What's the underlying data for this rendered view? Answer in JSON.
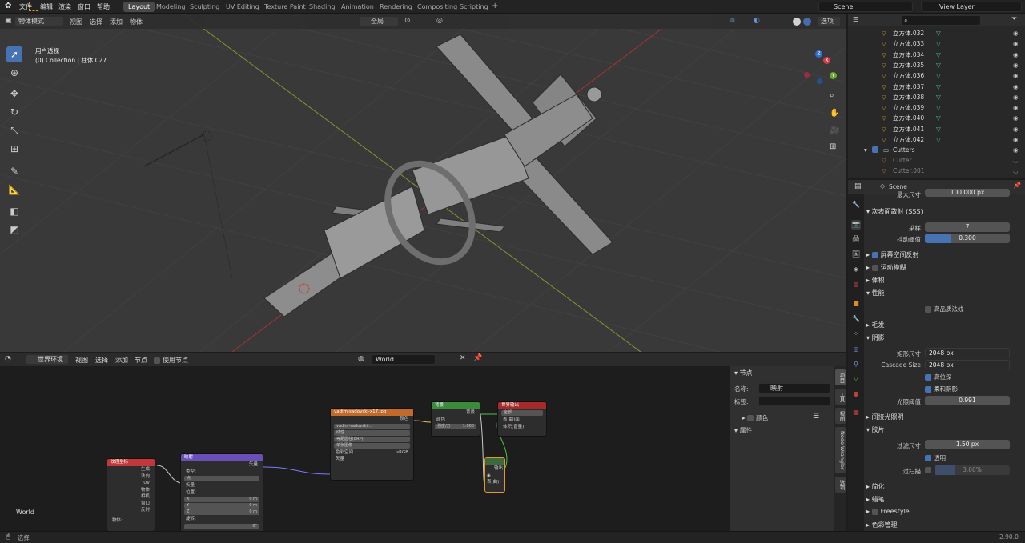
{
  "topbar": {
    "menus": [
      "文件",
      "编辑",
      "渲染",
      "窗口",
      "帮助"
    ],
    "workspaces": [
      "Layout",
      "Modeling",
      "Sculpting",
      "UV Editing",
      "Texture Paint",
      "Shading",
      "Animation",
      "Rendering",
      "Compositing",
      "Scripting"
    ],
    "scene": "Scene",
    "view_layer": "View Layer"
  },
  "viewport": {
    "mode": "物体模式",
    "menus": [
      "视图",
      "选择",
      "添加",
      "物体"
    ],
    "transform": "全局",
    "options": "选项",
    "view_name": "用户透视",
    "collection_info": "(0) Collection | 柱体.027",
    "gizmo_axes": [
      "X",
      "Y",
      "Z"
    ]
  },
  "node_editor": {
    "type": "世界环境",
    "menus": [
      "视图",
      "选择",
      "添加",
      "节点"
    ],
    "use_nodes": "使用节点",
    "world_name": "World",
    "world_label": "World",
    "nodes": {
      "texcoord": {
        "title": "纹理坐标",
        "outputs": [
          "生成",
          "法向",
          "UV",
          "物体",
          "相机",
          "窗口",
          "反射"
        ],
        "object_label": "物体:"
      },
      "mapping": {
        "title": "映射",
        "output": "矢量",
        "type_label": "类型:",
        "type_value": "点",
        "vector_label": "矢量",
        "location_label": "位置:",
        "x": "X",
        "y": "Y",
        "z": "Z",
        "x_val": "0 m",
        "y_val": "0 m",
        "z_val": "0 m",
        "rotation_label": "旋转:",
        "rot_x": "0°"
      },
      "envtex": {
        "title": "vadim-sadovski-x17.jpg",
        "output": "颜色",
        "image": "vadim-sadovski-...",
        "interp": "线性",
        "proj": "等距圆柱(ERP)",
        "ext": "单张图像",
        "colorspace_label": "色彩空间",
        "colorspace": "sRGB",
        "input": "矢量"
      },
      "background": {
        "title": "背景",
        "output": "背景",
        "color": "颜色",
        "strength_label": "强度/力",
        "strength": "1.000"
      },
      "output": {
        "title": "世界输出",
        "target": "全部",
        "surface": "表(曲)面",
        "volume": "体积(音量)"
      },
      "reroute": {
        "output": "输出",
        "surface": "表(曲)"
      }
    }
  },
  "node_sidebar": {
    "section": "节点",
    "name_label": "名称:",
    "name_value": "映射",
    "label_label": "标签:",
    "color": "颜色",
    "properties": "属性",
    "tabs": [
      "项目",
      "工具",
      "视图",
      "Node Wrangler",
      "选项"
    ]
  },
  "outliner": {
    "items": [
      "立方体.032",
      "立方体.033",
      "立方体.034",
      "立方体.035",
      "立方体.036",
      "立方体.037",
      "立方体.038",
      "立方体.039",
      "立方体.040",
      "立方体.041",
      "立方体.042"
    ],
    "collection": "Cutters",
    "cutters": [
      "Cutter",
      "Cutter.001"
    ]
  },
  "properties": {
    "scene": "Scene",
    "max_size_label": "最大尺寸",
    "max_size": "100.000 px",
    "sss": "次表面散射 (SSS)",
    "samples_label": "采样",
    "samples": "7",
    "jitter_label": "抖动阈值",
    "jitter": "0.300",
    "jitter_frac": 0.3,
    "ssr": "屏幕空间反射",
    "motion_blur": "运动模糊",
    "volumetrics": "体积",
    "performance": "性能",
    "hq_normals": "高品质法线",
    "hair": "毛发",
    "shadows": "阴影",
    "cube_size_label": "矩形尺寸",
    "cube_size": "2048 px",
    "cascade_label": "Cascade Size",
    "cascade_size": "2048 px",
    "high_bit": "高位深",
    "soft_shadows": "柔和阴影",
    "light_threshold_label": "光照阈值",
    "light_threshold": "0.991",
    "indirect": "间接光照明",
    "film": "胶片",
    "filter_label": "过滤尺寸",
    "filter_size": "1.50 px",
    "transparent": "透明",
    "overscan_label": "过扫描",
    "overscan": "3.00%",
    "simplify": "简化",
    "grease": "蜡笔",
    "freestyle": "Freestyle",
    "color_mgmt": "色彩管理"
  },
  "status": {
    "select": "选择",
    "version": "2.90.0"
  },
  "colors": {
    "accent": "#4772b3",
    "texcoord": "#c2383a",
    "mapping": "#6b4fb8",
    "envtex": "#c26a2a",
    "background": "#3c8a3c",
    "worldout": "#a52a2a"
  }
}
